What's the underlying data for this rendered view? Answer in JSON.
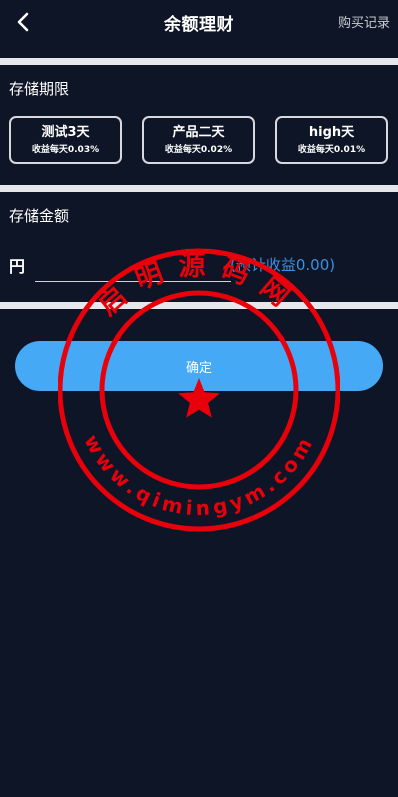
{
  "header": {
    "title": "余额理财",
    "records_label": "购买记录",
    "back_icon": "chevron-left-icon"
  },
  "term_section": {
    "title": "存储期限",
    "plans": [
      {
        "name": "测试3天",
        "rate": "收益每天0.03%"
      },
      {
        "name": "产品二天",
        "rate": "收益每天0.02%"
      },
      {
        "name": "high天",
        "rate": "收益每天0.01%"
      }
    ]
  },
  "amount_section": {
    "title": "存储金额",
    "currency": "円",
    "input_value": "",
    "expected_income": "(预计收益0.00)"
  },
  "confirm_label": "确定",
  "watermark": {
    "top_text": "启明源码网",
    "bottom_text": "www.qimingym.com"
  },
  "colors": {
    "background": "#0e1526",
    "divider": "#e6e7ea",
    "accent": "#45a9f5",
    "income_text": "#3d8fe0",
    "stamp": "#e8000b"
  }
}
